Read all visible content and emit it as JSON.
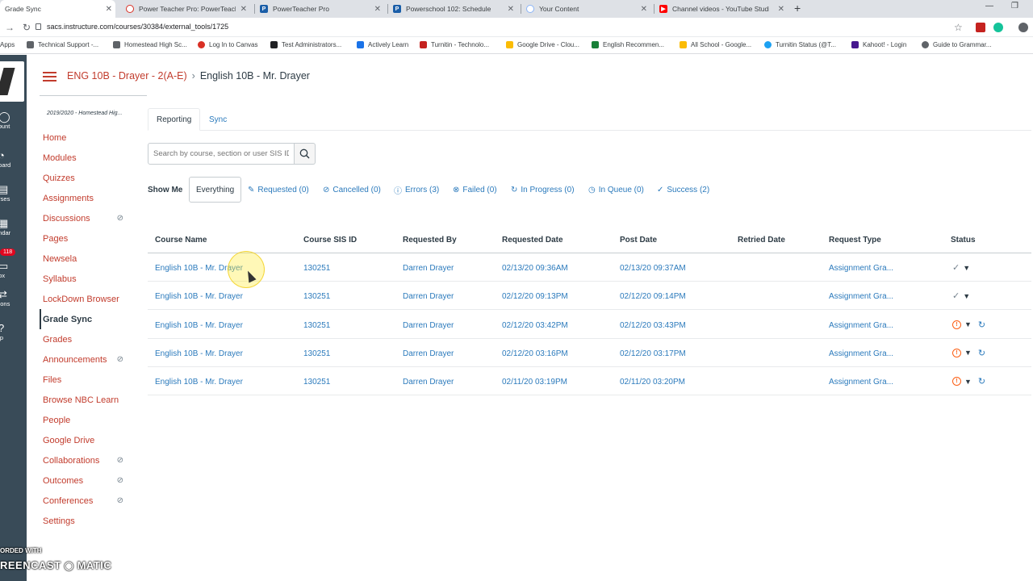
{
  "browser": {
    "tabs": [
      {
        "label": "Grade Sync",
        "active": true,
        "color": "#394b58"
      },
      {
        "label": "Power Teacher Pro: PowerTeacher",
        "color": "#d93025"
      },
      {
        "label": "PowerTeacher Pro",
        "color": "#1a5ea8"
      },
      {
        "label": "Powerschool 102: Schedule",
        "color": "#1a5ea8"
      },
      {
        "label": "Your Content",
        "color": "#8ab4f8"
      },
      {
        "label": "Channel videos - YouTube Studio",
        "color": "#ff0000"
      }
    ],
    "url": "sacs.instructure.com/courses/30384/external_tools/1725",
    "bookmarks": [
      {
        "label": "Apps"
      },
      {
        "label": "Technical Support -..."
      },
      {
        "label": "Homestead High Sc..."
      },
      {
        "label": "Log In to Canvas"
      },
      {
        "label": "Test Administrators..."
      },
      {
        "label": "Actively Learn"
      },
      {
        "label": "Turnitin - Technolo..."
      },
      {
        "label": "Google Drive - Clou..."
      },
      {
        "label": "English Recommen..."
      },
      {
        "label": "All School - Google..."
      },
      {
        "label": "Turnitin Status (@T..."
      },
      {
        "label": "Kahoot! - Login"
      },
      {
        "label": "Guide to Grammar..."
      }
    ]
  },
  "global_nav": {
    "items": [
      {
        "label": "count",
        "icon": "account-icon"
      },
      {
        "label": "board",
        "icon": "dashboard-icon"
      },
      {
        "label": "urses",
        "icon": "courses-icon"
      },
      {
        "label": "endar",
        "icon": "calendar-icon"
      },
      {
        "label": "box",
        "icon": "inbox-icon"
      },
      {
        "label": "mons",
        "icon": "commons-icon"
      },
      {
        "label": "elp",
        "icon": "help-icon"
      }
    ],
    "inbox_badge": "118"
  },
  "breadcrumb": {
    "course": "ENG 10B - Drayer - 2(A-E)",
    "separator": "›",
    "current": "English 10B - Mr. Drayer"
  },
  "course_nav": {
    "term": "2019/2020 - Homestead Hig...",
    "items": [
      {
        "label": "Home"
      },
      {
        "label": "Modules"
      },
      {
        "label": "Quizzes"
      },
      {
        "label": "Assignments"
      },
      {
        "label": "Discussions",
        "hidden": true
      },
      {
        "label": "Pages"
      },
      {
        "label": "Newsela"
      },
      {
        "label": "Syllabus"
      },
      {
        "label": "LockDown Browser"
      },
      {
        "label": "Grade Sync",
        "active": true
      },
      {
        "label": "Grades"
      },
      {
        "label": "Announcements",
        "hidden": true
      },
      {
        "label": "Files"
      },
      {
        "label": "Browse NBC Learn"
      },
      {
        "label": "People"
      },
      {
        "label": "Google Drive"
      },
      {
        "label": "Collaborations",
        "hidden": true
      },
      {
        "label": "Outcomes",
        "hidden": true
      },
      {
        "label": "Conferences",
        "hidden": true
      },
      {
        "label": "Settings"
      }
    ]
  },
  "main": {
    "tabs": [
      {
        "label": "Reporting",
        "active": true
      },
      {
        "label": "Sync"
      }
    ],
    "search": {
      "placeholder": "Search by course, section or user SIS ID"
    },
    "show_me_label": "Show Me",
    "filters": [
      {
        "label": "Everything",
        "icon": ""
      },
      {
        "label": "Requested (0)",
        "icon": "✎"
      },
      {
        "label": "Cancelled (0)",
        "icon": "⊘"
      },
      {
        "label": "Errors (3)",
        "icon": "ⓘ"
      },
      {
        "label": "Failed (0)",
        "icon": "⊗"
      },
      {
        "label": "In Progress (0)",
        "icon": "↻"
      },
      {
        "label": "In Queue (0)",
        "icon": "◷"
      },
      {
        "label": "Success (2)",
        "icon": "✓"
      }
    ],
    "table": {
      "headers": [
        "Course Name",
        "Course SIS ID",
        "Requested By",
        "Requested Date",
        "Post Date",
        "Retried Date",
        "Request Type",
        "Status"
      ],
      "rows": [
        {
          "course": "English 10B - Mr. Drayer",
          "sis": "130251",
          "by": "Darren Drayer",
          "requested": "02/13/20 09:36AM",
          "post": "02/13/20 09:37AM",
          "retried": "",
          "type": "Assignment Gra...",
          "status": "success"
        },
        {
          "course": "English 10B - Mr. Drayer",
          "sis": "130251",
          "by": "Darren Drayer",
          "requested": "02/12/20 09:13PM",
          "post": "02/12/20 09:14PM",
          "retried": "",
          "type": "Assignment Gra...",
          "status": "success"
        },
        {
          "course": "English 10B - Mr. Drayer",
          "sis": "130251",
          "by": "Darren Drayer",
          "requested": "02/12/20 03:42PM",
          "post": "02/12/20 03:43PM",
          "retried": "",
          "type": "Assignment Gra...",
          "status": "error"
        },
        {
          "course": "English 10B - Mr. Drayer",
          "sis": "130251",
          "by": "Darren Drayer",
          "requested": "02/12/20 03:16PM",
          "post": "02/12/20 03:17PM",
          "retried": "",
          "type": "Assignment Gra...",
          "status": "error"
        },
        {
          "course": "English 10B - Mr. Drayer",
          "sis": "130251",
          "by": "Darren Drayer",
          "requested": "02/11/20 03:19PM",
          "post": "02/11/20 03:20PM",
          "retried": "",
          "type": "Assignment Gra...",
          "status": "error"
        }
      ]
    }
  },
  "watermark": {
    "line1": "ORDED WITH",
    "line2": "REENCAST ◉ MATIC"
  },
  "colors": {
    "brand": "#c23c2d",
    "link": "#2b7abc",
    "nav_bg": "#394b58",
    "error": "#fc5e13"
  }
}
